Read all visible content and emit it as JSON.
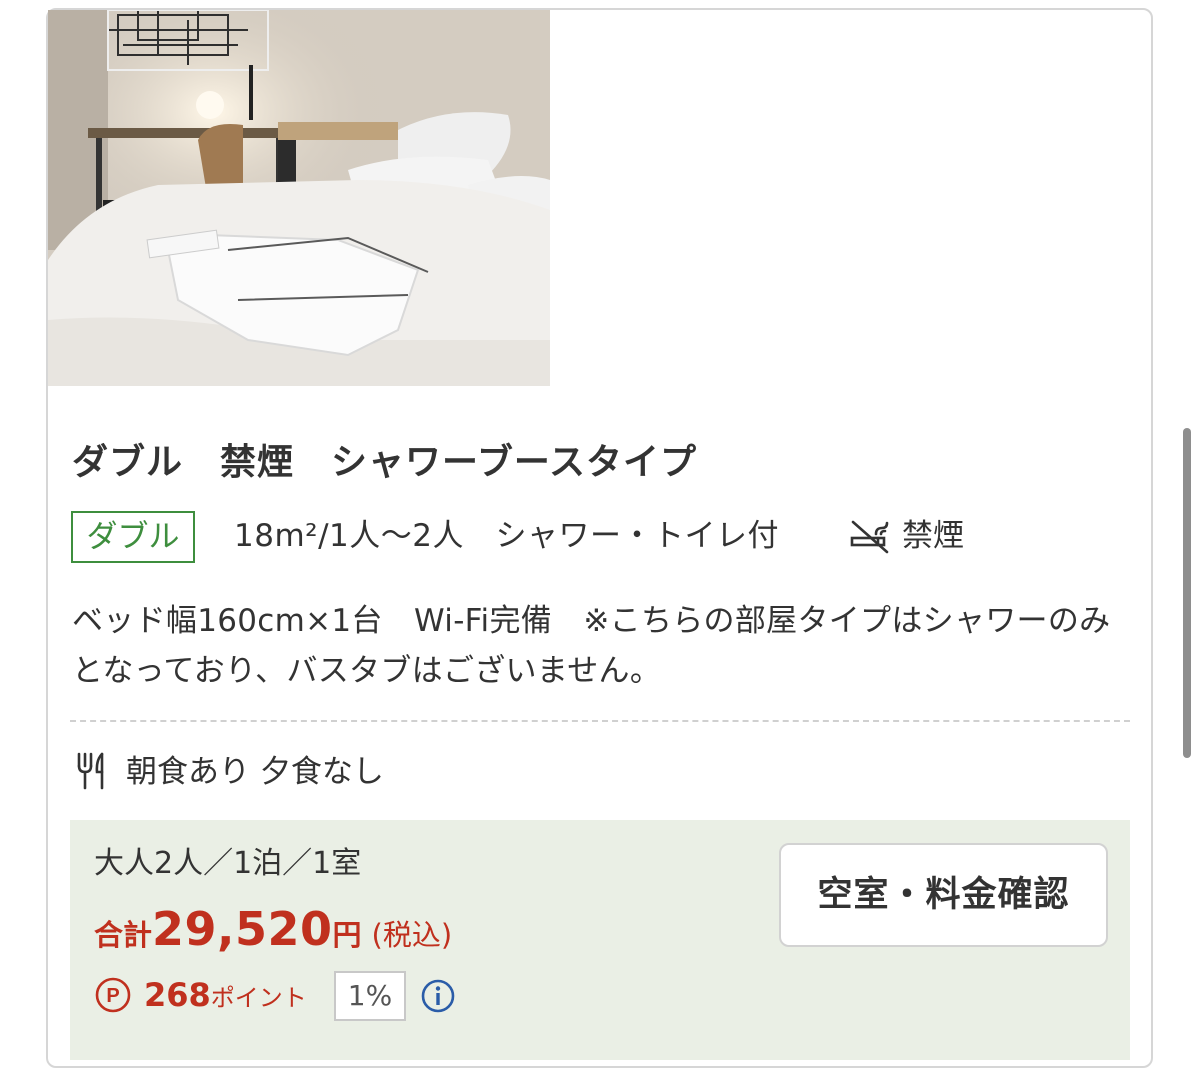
{
  "room": {
    "title": "ダブル　禁煙　シャワーブースタイプ",
    "type_badge": "ダブル",
    "spec": "18m²/1人〜2人　シャワー・トイレ付",
    "smoking": "禁煙",
    "description": "ベッド幅160cm×1台　Wi-Fi完備　※こちらの部屋タイプはシャワーのみとなっており、バスタブはございません。",
    "meals": "朝食あり 夕食なし"
  },
  "price": {
    "guests": "大人2人／1泊／1室",
    "total_label": "合計",
    "total_amount": "29,520",
    "currency": "円",
    "tax_note": "(税込)",
    "points": "268",
    "points_unit": "ポイント",
    "points_rate": "1%",
    "check_button": "空室・料金確認"
  },
  "icons": {
    "no_smoking": "no-smoking-icon",
    "meal": "fork-knife-icon",
    "point": "point-p-icon",
    "info": "info-icon"
  },
  "colors": {
    "accent_green": "#3e8e3e",
    "price_red": "#c0301e",
    "price_bg": "#eaefe5",
    "info_blue": "#2a5ca8"
  }
}
